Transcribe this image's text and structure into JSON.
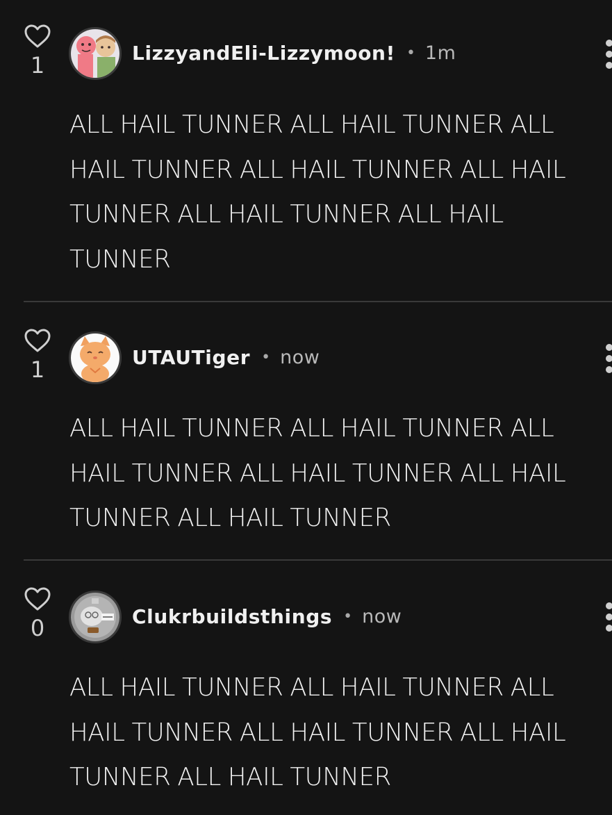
{
  "comments": [
    {
      "likes": "1",
      "username": "LizzyandEli-Lizzymoon!",
      "separator": "•",
      "time": "1m",
      "text": "ALL HAIL TUNNER ALL HAIL TUNNER ALL HAIL TUNNER ALL HAIL TUNNER ALL HAIL TUNNER ALL HAIL TUNNER ALL HAIL TUNNER",
      "avatar_icon": "pink-character-avatar-icon"
    },
    {
      "likes": "1",
      "username": "UTAUTiger",
      "separator": "•",
      "time": "now",
      "text": "ALL HAIL TUNNER ALL HAIL TUNNER ALL HAIL TUNNER ALL HAIL TUNNER ALL HAIL TUNNER ALL HAIL TUNNER",
      "avatar_icon": "orange-cat-avatar-icon"
    },
    {
      "likes": "0",
      "username": "Clukrbuildsthings",
      "separator": "•",
      "time": "now",
      "text": "ALL HAIL TUNNER ALL HAIL TUNNER ALL HAIL TUNNER ALL HAIL TUNNER ALL HAIL TUNNER ALL HAIL TUNNER",
      "avatar_icon": "gray-robot-avatar-icon"
    }
  ],
  "colors": {
    "background": "#141414",
    "text": "#f2f2f2",
    "muted": "#b9b9b9",
    "divider": "#3a3a3a"
  }
}
